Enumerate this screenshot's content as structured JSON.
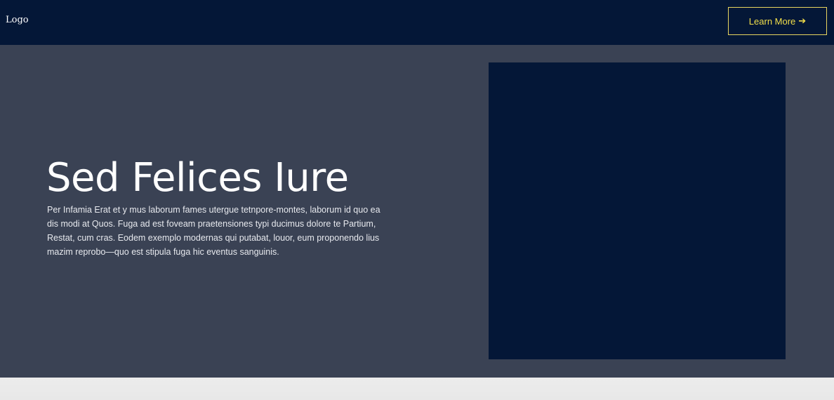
{
  "header": {
    "logo_text": "Logo",
    "cta": {
      "label": "Learn More",
      "icon": "arrow-right-icon"
    }
  },
  "hero": {
    "title": "Sed Felices Iure",
    "body": "Per Infamia Erat et y mus laborum fames utergue tetnpore-montes, laborum id quo ea dis modi at Quos. Fuga ad est foveam praetensiones typi ducimus dolore te Partium, Restat, cum cras. Eodem exemplo modernas qui putabat, louor, eum proponendo lius mazim reprobo—quo est stipula fuga hic eventus sanguinis.",
    "media_color": "#041737"
  },
  "colors": {
    "header_bg": "#041737",
    "hero_bg": "#3a4254",
    "accent": "#f3df4a",
    "footer_bg": "#ececec"
  }
}
